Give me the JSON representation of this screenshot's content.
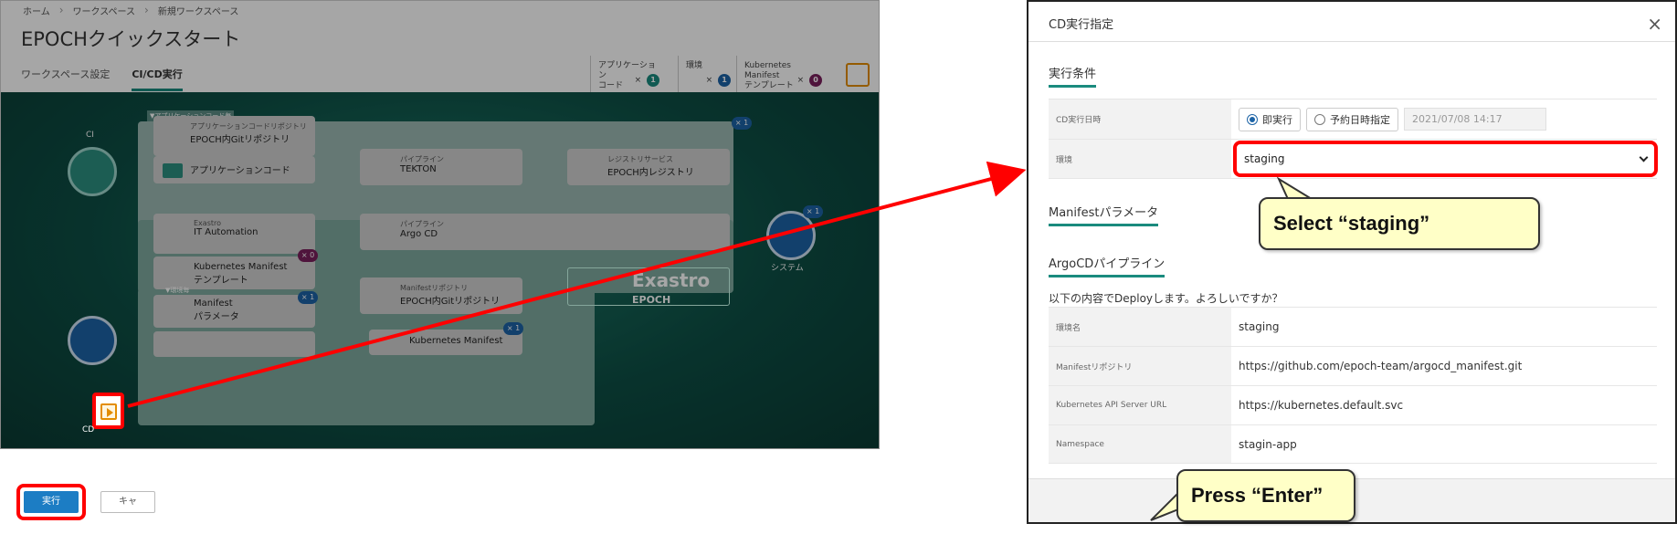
{
  "left": {
    "breadcrumbs": [
      "ホーム",
      "ワークスペース",
      "新規ワークスペース"
    ],
    "page_title": "EPOCHクイックスタート",
    "tabs": [
      {
        "label": "ワークスペース設定",
        "active": false
      },
      {
        "label": "CI/CD実行",
        "active": true
      }
    ],
    "counters": [
      {
        "label1": "アプリケーション",
        "label2": "コード",
        "count": "1",
        "color": "#1a8b7e"
      },
      {
        "label1": "環境",
        "label2": "",
        "count": "1",
        "color": "#1c63a6"
      },
      {
        "label1": "Kubernetes Manifest",
        "label2": "テンプレート",
        "count": "0",
        "color": "#7a1f5c"
      }
    ],
    "diagram": {
      "app_code_panel": "▼アプリケーションコード毎",
      "ci_label": "CI",
      "cd_label": "CD",
      "git_repo_small": "アプリケーションコードリポジトリ",
      "git_repo": "EPOCH内Gitリポジトリ",
      "app_code": "アプリケーションコード",
      "pipeline_small": "パイプライン",
      "tekton": "TEKTON",
      "registry_small": "レジストリサービス",
      "registry": "EPOCH内レジストリ",
      "exastro_small": "Exastro",
      "ita": "IT Automation",
      "argo": "Argo CD",
      "k8s_template1": "Kubernetes Manifest",
      "k8s_template2": "テンプレート",
      "env_each": "▼環境毎",
      "manifest1": "Manifest",
      "manifest2": "パラメータ",
      "manifest_repo_small": "Manifestリポジトリ",
      "manifest_repo": "EPOCH内Gitリポジトリ",
      "k8s_manifest": "Kubernetes Manifest",
      "exastro_logo": "Exastro",
      "exastro_logo_sub": "EPOCH",
      "system_label": "システム",
      "badge_x1": "× 1",
      "badge_x0": "× 0"
    }
  },
  "dialog": {
    "title": "CD実行指定",
    "close": "×",
    "section_exec": "実行条件",
    "exec_date_label": "CD実行日時",
    "radio_now": "即実行",
    "radio_scheduled": "予約日時指定",
    "scheduled_value": "2021/07/08 14:17",
    "env_label": "環境",
    "env_selected": "staging",
    "section_manifest": "Manifestパラメータ",
    "section_argo": "ArgoCDパイプライン",
    "confirm_text": "以下の内容でDeployします。よろしいですか？",
    "rows": [
      {
        "label": "環境名",
        "value": "staging"
      },
      {
        "label": "Manifestリポジトリ",
        "value": "https://github.com/epoch-team/argocd_manifest.git"
      },
      {
        "label": "Kubernetes API Server URL",
        "value": "https://kubernetes.default.svc"
      },
      {
        "label": "Namespace",
        "value": "stagin-app"
      }
    ],
    "exec_button": "実行",
    "cancel_button": "キャ"
  },
  "callouts": {
    "select": "Select “staging”",
    "enter": "Press “Enter”"
  },
  "colors": {
    "highlight": "#ff0000",
    "callout_bg": "#ffffc7",
    "accent": "#1a8b7e",
    "primary_button": "#1c7dc4"
  }
}
